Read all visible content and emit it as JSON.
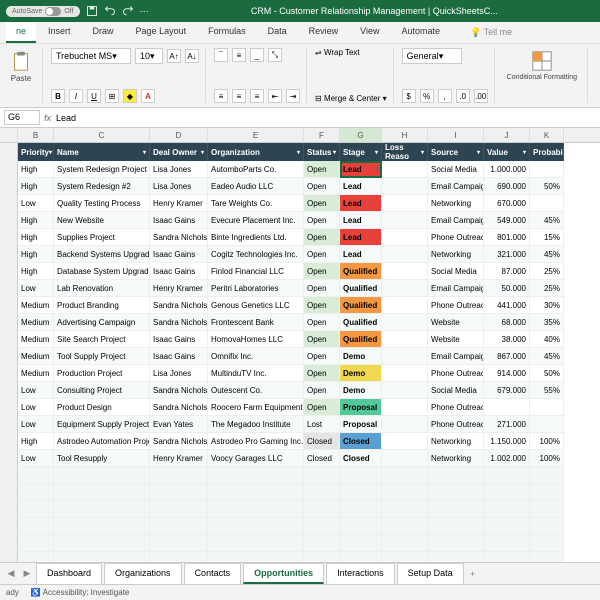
{
  "app": {
    "autosave_label": "AutoSave",
    "autosave_state": "Off",
    "title": "CRM - Customer Relationship Management | QuickSheetsC..."
  },
  "ribbon_tabs": [
    "ne",
    "Insert",
    "Draw",
    "Page Layout",
    "Formulas",
    "Data",
    "Review",
    "View",
    "Automate"
  ],
  "tellme": "Tell me",
  "ribbon": {
    "paste": "Paste",
    "font_name": "Trebuchet MS",
    "font_size": "10",
    "wrap": "Wrap Text",
    "merge": "Merge & Center",
    "numfmt": "General",
    "condfmt": "Conditional Formatting"
  },
  "formula": {
    "namebox": "G6",
    "fx": "fx",
    "value": "Lead"
  },
  "cols": [
    "B",
    "C",
    "D",
    "E",
    "F",
    "G",
    "H",
    "I",
    "J",
    "K"
  ],
  "active_col": "G",
  "headers": [
    "Priority",
    "Name",
    "Deal Owner",
    "Organization",
    "Status",
    "Stage",
    "Loss Reaso",
    "Source",
    "Value",
    "Probability"
  ],
  "rows": [
    {
      "priority": "High",
      "name": "System Redesign Project",
      "owner": "Lisa Jones",
      "org": "AutomboParts Co.",
      "status": "Open",
      "stage": "Lead",
      "reason": "",
      "source": "Social Media",
      "value": "1.000.000",
      "prob": ""
    },
    {
      "priority": "High",
      "name": "System Redesign #2",
      "owner": "Lisa Jones",
      "org": "Eadeo Audio LLC",
      "status": "Open",
      "stage": "Lead",
      "reason": "",
      "source": "Email Campaign",
      "value": "690.000",
      "prob": "50%"
    },
    {
      "priority": "Low",
      "name": "Quality Testing Process",
      "owner": "Henry Kramer",
      "org": "Tare Weights Co.",
      "status": "Open",
      "stage": "Lead",
      "reason": "",
      "source": "Networking",
      "value": "670.000",
      "prob": ""
    },
    {
      "priority": "High",
      "name": "New Website",
      "owner": "Isaac Gains",
      "org": "Evecure Placement Inc.",
      "status": "Open",
      "stage": "Lead",
      "reason": "",
      "source": "Email Campaign",
      "value": "549.000",
      "prob": "45%"
    },
    {
      "priority": "High",
      "name": "Supplies Project",
      "owner": "Sandra Nichols",
      "org": "Binte Ingredients Ltd.",
      "status": "Open",
      "stage": "Lead",
      "reason": "",
      "source": "Phone Outreach",
      "value": "801.000",
      "prob": "15%"
    },
    {
      "priority": "High",
      "name": "Backend Systems Upgrade",
      "owner": "Isaac Gains",
      "org": "Cogitz Technologies Inc.",
      "status": "Open",
      "stage": "Lead",
      "reason": "",
      "source": "Networking",
      "value": "321.000",
      "prob": "45%"
    },
    {
      "priority": "High",
      "name": "Database System Upgrade",
      "owner": "Isaac Gains",
      "org": "Finlod Financial LLC",
      "status": "Open",
      "stage": "Qualified",
      "reason": "",
      "source": "Social Media",
      "value": "87.000",
      "prob": "25%"
    },
    {
      "priority": "Low",
      "name": "Lab Renovation",
      "owner": "Henry Kramer",
      "org": "Peritri Laboratories",
      "status": "Open",
      "stage": "Qualified",
      "reason": "",
      "source": "Email Campaign",
      "value": "50.000",
      "prob": "25%"
    },
    {
      "priority": "Medium",
      "name": "Product Branding",
      "owner": "Sandra Nichols",
      "org": "Genous Genetics LLC",
      "status": "Open",
      "stage": "Qualified",
      "reason": "",
      "source": "Phone Outreach",
      "value": "441.000",
      "prob": "30%"
    },
    {
      "priority": "Medium",
      "name": "Advertising Campaign",
      "owner": "Sandra Nichols",
      "org": "Frontescent Bank",
      "status": "Open",
      "stage": "Qualified",
      "reason": "",
      "source": "Website",
      "value": "68.000",
      "prob": "35%"
    },
    {
      "priority": "Medium",
      "name": "Site Search Project",
      "owner": "Isaac Gains",
      "org": "HomovaHomes LLC",
      "status": "Open",
      "stage": "Qualified",
      "reason": "",
      "source": "Website",
      "value": "38.000",
      "prob": "40%"
    },
    {
      "priority": "Medium",
      "name": "Tool Supply Project",
      "owner": "Isaac Gains",
      "org": "Omnifix Inc.",
      "status": "Open",
      "stage": "Demo",
      "reason": "",
      "source": "Email Campaign",
      "value": "867.000",
      "prob": "45%"
    },
    {
      "priority": "Medium",
      "name": "Production Project",
      "owner": "Lisa Jones",
      "org": "MultinduTV Inc.",
      "status": "Open",
      "stage": "Demo",
      "reason": "",
      "source": "Phone Outreach",
      "value": "914.000",
      "prob": "50%"
    },
    {
      "priority": "Low",
      "name": "Consulting Project",
      "owner": "Sandra Nichols",
      "org": "Outescent Co.",
      "status": "Open",
      "stage": "Demo",
      "reason": "",
      "source": "Social Media",
      "value": "679.000",
      "prob": "55%"
    },
    {
      "priority": "Low",
      "name": "Product Design",
      "owner": "Sandra Nichols",
      "org": "Roocero Farm Equipment Co.",
      "status": "Open",
      "stage": "Proposal",
      "reason": "",
      "source": "Phone Outreach",
      "value": "",
      "prob": ""
    },
    {
      "priority": "Low",
      "name": "Equipment Supply Project",
      "owner": "Evan Yates",
      "org": "The Megadoo Institute",
      "status": "Lost",
      "stage": "Proposal",
      "reason": "",
      "source": "Phone Outreach",
      "value": "271.000",
      "prob": ""
    },
    {
      "priority": "High",
      "name": "Astrodeo Automation Project",
      "owner": "Sandra Nichols",
      "org": "Astrodeo Pro Gaming Inc.",
      "status": "Closed",
      "stage": "Closed",
      "reason": "",
      "source": "Networking",
      "value": "1.150.000",
      "prob": "100%"
    },
    {
      "priority": "Low",
      "name": "Tool Resupply",
      "owner": "Henry Kramer",
      "org": "Voocy Garages LLC",
      "status": "Closed",
      "stage": "Closed",
      "reason": "",
      "source": "Networking",
      "value": "1.002.000",
      "prob": "100%"
    }
  ],
  "sheets": [
    "Dashboard",
    "Organizations",
    "Contacts",
    "Opportunities",
    "Interactions",
    "Setup Data"
  ],
  "active_sheet": "Opportunities",
  "status": {
    "ready": "ady",
    "access": "Accessibility: Investigate"
  }
}
